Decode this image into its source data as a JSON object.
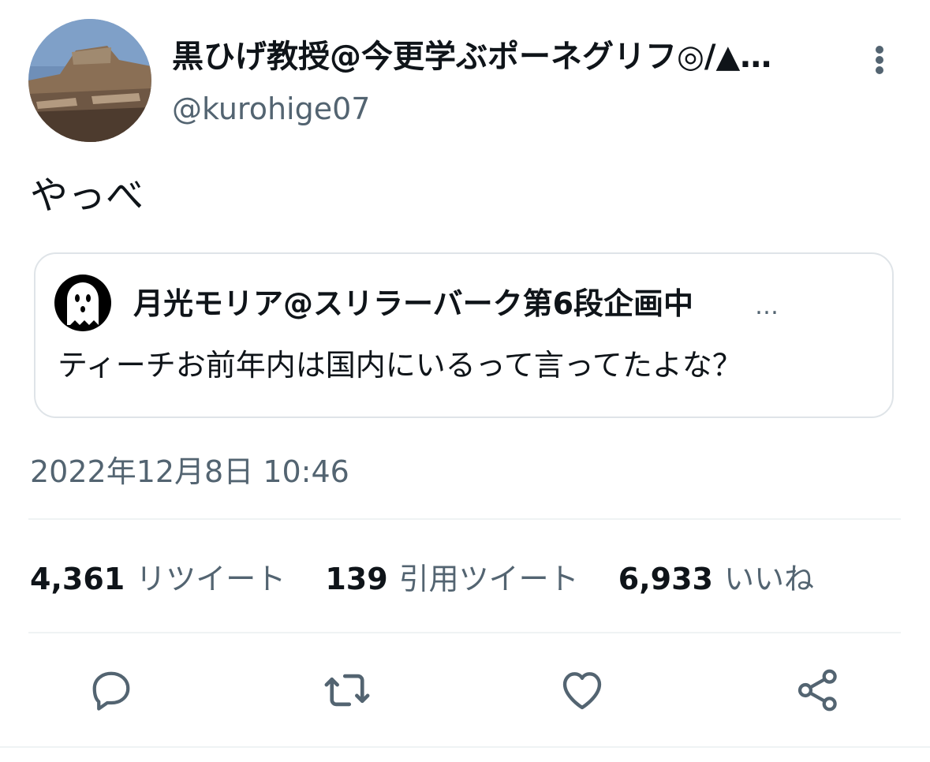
{
  "tweet": {
    "author": {
      "display_name": "黒ひげ教授@今更学ぶポーネグリフ◎/▲…",
      "handle": "@kurohige07"
    },
    "text": "やっべ",
    "quoted": {
      "author_name": "月光モリア@スリラーバーク第6段企画中",
      "ellipsis": "…",
      "text": "ティーチお前年内は国内にいるって言ってたよな？"
    },
    "timestamp": "2022年12月8日 10:46",
    "stats": {
      "retweets": {
        "count": "4,361",
        "label": "リツイート"
      },
      "quotes": {
        "count": "139",
        "label": "引用ツイート"
      },
      "likes": {
        "count": "6,933",
        "label": "いいね"
      }
    }
  },
  "icons": {
    "more": "more-vertical-icon",
    "reply": "reply-icon",
    "retweet": "retweet-icon",
    "like": "heart-icon",
    "share": "share-icon"
  },
  "colors": {
    "primary_text": "#0f1419",
    "secondary_text": "#536471",
    "border": "#dfe4e8",
    "divider": "#eff3f4"
  }
}
